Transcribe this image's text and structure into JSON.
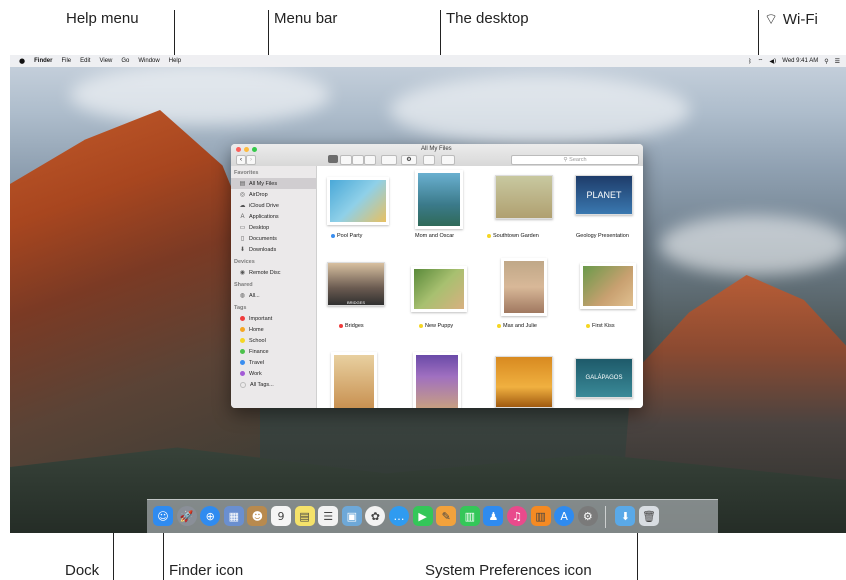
{
  "callouts": {
    "help_menu": "Help menu",
    "menu_bar": "Menu bar",
    "desktop": "The desktop",
    "wifi": "Wi-Fi",
    "dock": "Dock",
    "finder_icon": "Finder icon",
    "system_preferences_icon": "System Preferences icon"
  },
  "menubar": {
    "apple": "",
    "items": [
      "Finder",
      "File",
      "Edit",
      "View",
      "Go",
      "Window",
      "Help"
    ],
    "status_icons": [
      "bluetooth-icon",
      "wifi-icon",
      "volume-icon"
    ],
    "clock": "Wed 9:41 AM"
  },
  "finder": {
    "title": "All My Files",
    "search_placeholder": "Search",
    "sidebar": {
      "favorites_heading": "Favorites",
      "favorites": [
        {
          "label": "All My Files",
          "icon": "▤"
        },
        {
          "label": "AirDrop",
          "icon": "◎"
        },
        {
          "label": "iCloud Drive",
          "icon": "☁"
        },
        {
          "label": "Applications",
          "icon": "A"
        },
        {
          "label": "Desktop",
          "icon": "▭"
        },
        {
          "label": "Documents",
          "icon": "▯"
        },
        {
          "label": "Downloads",
          "icon": "⬇"
        }
      ],
      "devices_heading": "Devices",
      "devices": [
        {
          "label": "Remote Disc",
          "icon": "◉"
        }
      ],
      "shared_heading": "Shared",
      "shared": [
        {
          "label": "All...",
          "icon": "◍"
        }
      ],
      "tags_heading": "Tags",
      "tags": [
        {
          "label": "Important",
          "color": "#f03c3c"
        },
        {
          "label": "Home",
          "color": "#f5a623"
        },
        {
          "label": "School",
          "color": "#f5d623"
        },
        {
          "label": "Finance",
          "color": "#4cc14c"
        },
        {
          "label": "Travel",
          "color": "#3a8ef0"
        },
        {
          "label": "Work",
          "color": "#a35bd6"
        },
        {
          "label": "All Tags...",
          "color": "#cccccc"
        }
      ]
    },
    "files": [
      {
        "label": "Pool Party",
        "tag_color": "#3a8ef0"
      },
      {
        "label": "Mom and Oscar",
        "tag_color": ""
      },
      {
        "label": "Southtown Garden",
        "tag_color": "#f5d623"
      },
      {
        "label": "Geology Presentation",
        "tag_color": ""
      },
      {
        "label": "Bridges",
        "tag_color": "#f03c3c"
      },
      {
        "label": "New Puppy",
        "tag_color": "#f5d623"
      },
      {
        "label": "Max and Julie",
        "tag_color": "#f5d623"
      },
      {
        "label": "First Kiss",
        "tag_color": "#f5d623"
      }
    ],
    "file_thumb_text": {
      "planet": "PLANET",
      "galapagos": "GALÁPAGOS",
      "bridges": "BRIDGES"
    }
  },
  "dock": {
    "apps": [
      {
        "name": "finder-icon",
        "glyph": "☺",
        "color": "#2f8bf0"
      },
      {
        "name": "launchpad-icon",
        "glyph": "🚀",
        "color": "#8a8f98"
      },
      {
        "name": "safari-icon",
        "glyph": "⊕",
        "color": "#2f8bf0"
      },
      {
        "name": "photo-browser-icon",
        "glyph": "▦",
        "color": "#6a8fd0"
      },
      {
        "name": "contacts-icon",
        "glyph": "☻",
        "color": "#b88a4e"
      },
      {
        "name": "calendar-icon",
        "glyph": "9",
        "color": "#f5f5f5"
      },
      {
        "name": "notes-icon",
        "glyph": "▤",
        "color": "#f5e26a"
      },
      {
        "name": "reminders-icon",
        "glyph": "☰",
        "color": "#f2f2f2"
      },
      {
        "name": "preview-icon",
        "glyph": "▣",
        "color": "#6ea8d8"
      },
      {
        "name": "photos-icon",
        "glyph": "✿",
        "color": "#f2f2f2"
      },
      {
        "name": "messages-icon",
        "glyph": "…",
        "color": "#2f9bf0"
      },
      {
        "name": "facetime-icon",
        "glyph": "▶",
        "color": "#34c759"
      },
      {
        "name": "pages-icon",
        "glyph": "✎",
        "color": "#f2a23c"
      },
      {
        "name": "numbers-icon",
        "glyph": "▥",
        "color": "#34c759"
      },
      {
        "name": "keynote-icon",
        "glyph": "♟",
        "color": "#2f8bf0"
      },
      {
        "name": "itunes-icon",
        "glyph": "♫",
        "color": "#e94a8c"
      },
      {
        "name": "ibooks-icon",
        "glyph": "▥",
        "color": "#f58a23"
      },
      {
        "name": "app-store-icon",
        "glyph": "A",
        "color": "#2f8bf0"
      },
      {
        "name": "system-preferences-icon",
        "glyph": "⚙",
        "color": "#7a7a7a"
      },
      {
        "name": "downloads-folder-icon",
        "glyph": "⬇",
        "color": "#5aa9e8"
      },
      {
        "name": "trash-icon",
        "glyph": "🗑",
        "color": "#d8dde2"
      }
    ]
  }
}
